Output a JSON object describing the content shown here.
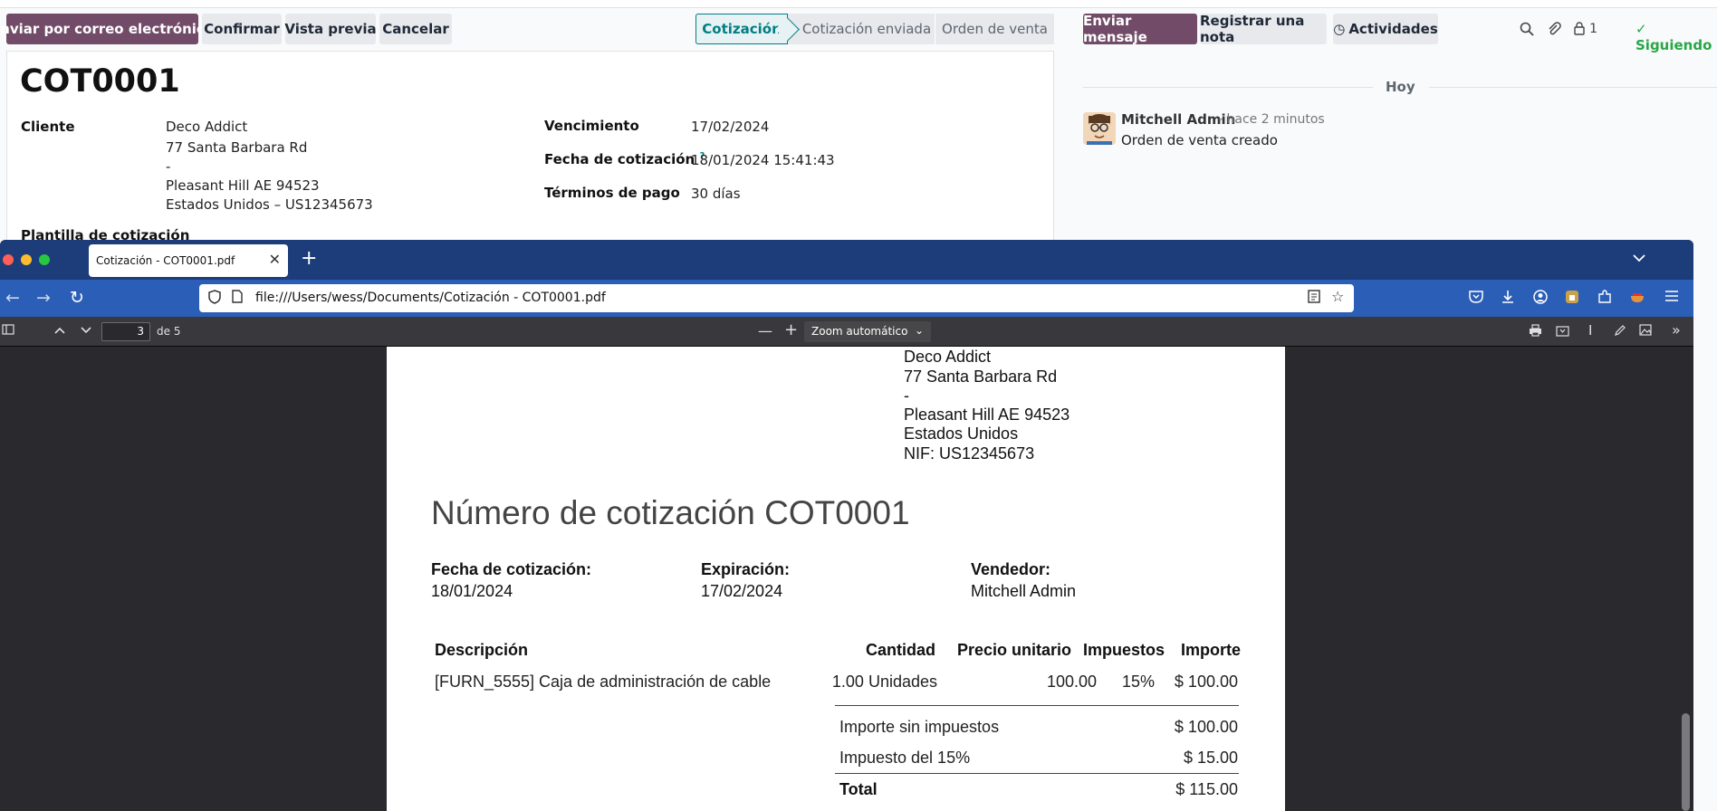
{
  "odoo": {
    "actions": {
      "email": "Enviar por correo electrónico",
      "confirm": "Confirmar",
      "preview": "Vista previa",
      "cancel": "Cancelar"
    },
    "status_bar": [
      "Cotización",
      "Cotización enviada",
      "Orden de venta"
    ],
    "record_title": "COT0001",
    "fields": {
      "customer_label": "Cliente",
      "customer_lines": [
        "Deco Addict",
        "77 Santa Barbara Rd",
        "-",
        "Pleasant Hill AE 94523",
        "Estados Unidos – US12345673"
      ],
      "template_label": "Plantilla de cotización",
      "expiration_label": "Vencimiento",
      "expiration_value": "17/02/2024",
      "quote_date_label": "Fecha de cotización",
      "quote_date_help": "?",
      "quote_date_value": "18/01/2024 15:41:43",
      "payment_terms_label": "Términos de pago",
      "payment_terms_value": "30 días"
    },
    "chatter": {
      "send_message": "Enviar mensaje",
      "log_note": "Registrar una nota",
      "activities": "Actividades",
      "followers_count": "1",
      "following": "Siguiendo",
      "date_separator": "Hoy",
      "message": {
        "author": "Mitchell Admin",
        "time": "- hace 2 minutos",
        "body": "Orden de venta creado"
      }
    }
  },
  "browser": {
    "tab_title": "Cotización - COT0001.pdf",
    "url": "file:///Users/wess/Documents/Cotización - COT0001.pdf",
    "pdf_toolbar": {
      "page_number": "3",
      "of_pages": "de 5",
      "zoom": "Zoom automático"
    }
  },
  "pdf": {
    "address_lines": [
      "Deco Addict",
      "77 Santa Barbara Rd",
      "-",
      "Pleasant Hill AE 94523",
      "Estados Unidos",
      "NIF: US12345673"
    ],
    "title": "Número de cotización COT0001",
    "info": {
      "quote_date_label": "Fecha de cotización:",
      "quote_date_value": "18/01/2024",
      "expiration_label": "Expiración:",
      "expiration_value": "17/02/2024",
      "salesperson_label": "Vendedor:",
      "salesperson_value": "Mitchell Admin"
    },
    "table": {
      "headers": {
        "description": "Descripción",
        "quantity": "Cantidad",
        "unit_price": "Precio unitario",
        "taxes": "Impuestos",
        "amount": "Importe"
      },
      "row": {
        "description": "[FURN_5555] Caja de administración de cable",
        "quantity": "1.00 Unidades",
        "unit_price": "100.00",
        "taxes": "15%",
        "amount": "$ 100.00"
      }
    },
    "totals": {
      "untaxed_label": "Importe sin impuestos",
      "untaxed_value": "$ 100.00",
      "tax_label": "Impuesto del 15%",
      "tax_value": "$ 15.00",
      "total_label": "Total",
      "total_value": "$ 115.00"
    }
  }
}
